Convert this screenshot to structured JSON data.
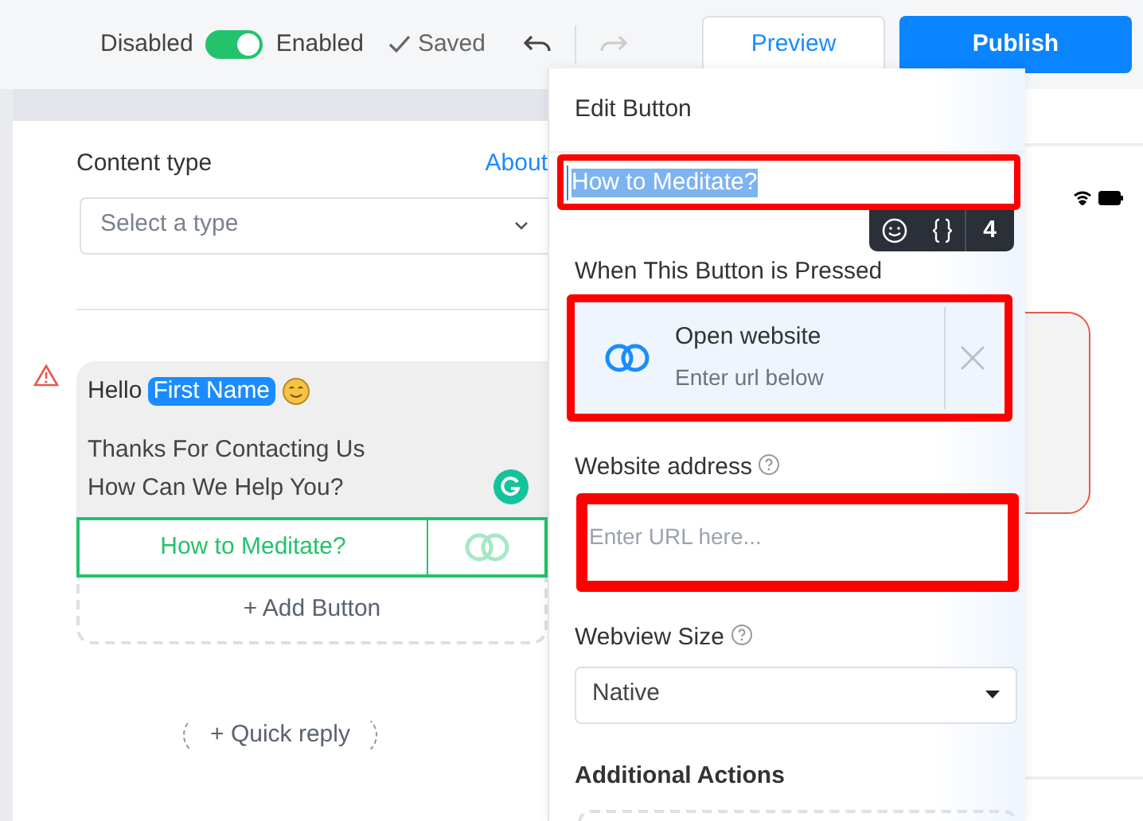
{
  "toolbar": {
    "off_label": "Disabled",
    "toggle": {
      "on": true
    },
    "on_label": "Enabled",
    "saved": "Saved",
    "preview": "Preview",
    "publish": "Publish"
  },
  "editor": {
    "content_type_label": "Content type",
    "about_link": "About",
    "content_type_select": {
      "placeholder": "Select a type"
    },
    "message": {
      "warning": true,
      "greeting": "Hello",
      "variable": "First Name",
      "lines": [
        "Thanks For Contacting Us",
        "How Can We Help You?"
      ]
    },
    "buttons": [
      {
        "label": "How to Meditate?",
        "selected": true
      }
    ],
    "add_button": "+ Add Button",
    "quick_reply": "+ Quick reply"
  },
  "edit_panel": {
    "title": "Edit Button",
    "button_title": {
      "value": "How to Meditate?"
    },
    "char_count": "4",
    "action_label": "When This Button is Pressed",
    "action": {
      "title": "Open website",
      "subtitle": "Enter url below"
    },
    "website_label": "Website address",
    "website_field": {
      "placeholder": "Enter URL here..."
    },
    "webview_label": "Webview Size",
    "webview_select": {
      "value": "Native"
    },
    "additional_label": "Additional Actions"
  }
}
